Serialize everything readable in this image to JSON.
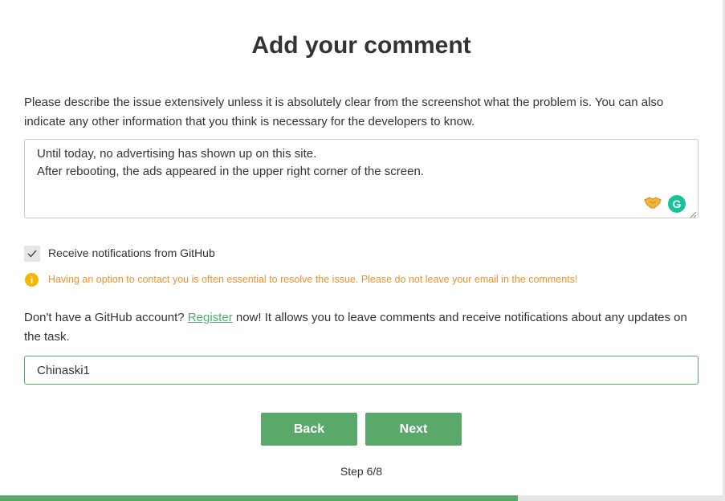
{
  "title": "Add your comment",
  "description": "Please describe the issue extensively unless it is absolutely clear from the screenshot what the problem is. You can also indicate any other information that you think is necessary for the developers to know.",
  "comment": {
    "lines": [
      "Until today, no advertising has shown up on this site.",
      "After rebooting, the ads appeared in the upper right corner of the screen."
    ],
    "grammarly_letter": "G"
  },
  "notifications": {
    "checked": true,
    "label": "Receive notifications from GitHub"
  },
  "warning": {
    "icon": "info-icon",
    "icon_glyph": "i",
    "text": "Having an option to contact you is often essential to resolve the issue. Please do not leave your email in the comments!"
  },
  "account": {
    "prefix": "Don't have a GitHub account? ",
    "register_label": "Register",
    "suffix": " now! It allows you to leave comments and receive notifications about any updates on the task."
  },
  "username": {
    "value": "Chinaski1"
  },
  "buttons": {
    "back": "Back",
    "next": "Next"
  },
  "step": {
    "label": "Step 6/8",
    "current": 6,
    "total": 8
  },
  "colors": {
    "accent": "#5aa86a",
    "warning_text": "#f0902a",
    "warning_icon": "#f5b700",
    "grammarly": "#15c39a"
  }
}
